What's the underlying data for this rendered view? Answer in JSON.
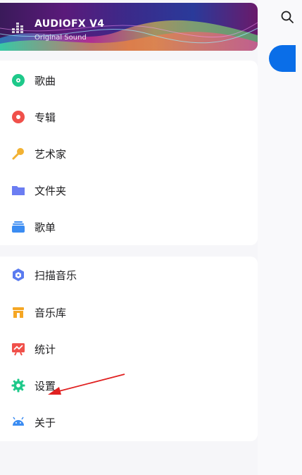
{
  "banner": {
    "title": "AUDIOFX V4",
    "subtitle": "Original Sound"
  },
  "menu_group_1": [
    {
      "label": "歌曲",
      "icon": "disc-icon",
      "color": "#1ec98a"
    },
    {
      "label": "专辑",
      "icon": "album-icon",
      "color": "#f0504a"
    },
    {
      "label": "艺术家",
      "icon": "microphone-icon",
      "color": "#f2b233"
    },
    {
      "label": "文件夹",
      "icon": "folder-icon",
      "color": "#6b7df2"
    },
    {
      "label": "歌单",
      "icon": "playlist-icon",
      "color": "#3b8cf2"
    }
  ],
  "menu_group_2": [
    {
      "label": "扫描音乐",
      "icon": "cube-scan-icon",
      "color": "#5a7bf0"
    },
    {
      "label": "音乐库",
      "icon": "store-icon",
      "color": "#f5a623"
    },
    {
      "label": "统计",
      "icon": "stats-icon",
      "color": "#f0504a"
    },
    {
      "label": "设置",
      "icon": "gear-icon",
      "color": "#1ec98a"
    },
    {
      "label": "关于",
      "icon": "android-icon",
      "color": "#3b8cf2"
    }
  ],
  "colors": {
    "accent": "#0a6ee8",
    "annotation_arrow": "#e02020"
  }
}
